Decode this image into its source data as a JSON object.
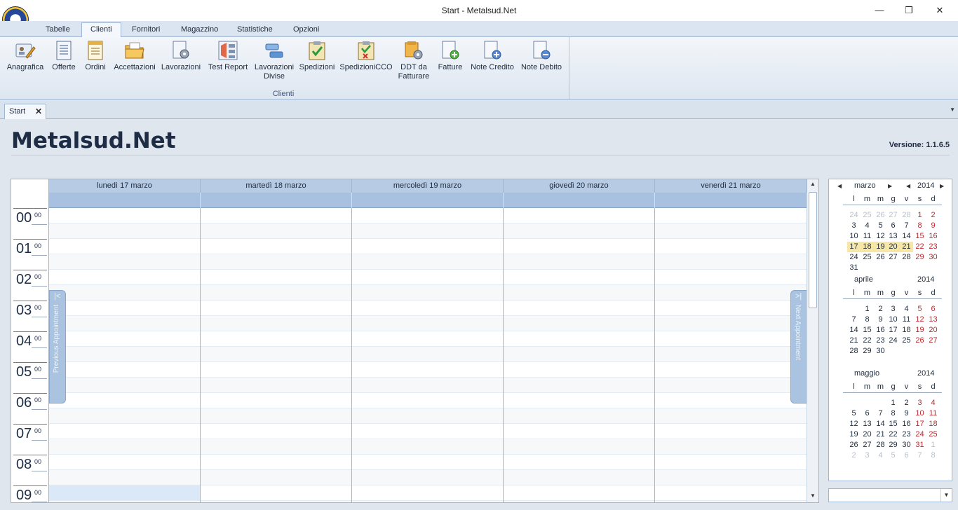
{
  "window": {
    "title": "Start - Metalsud.Net",
    "minimize": "—",
    "restore": "❐",
    "close": "✕"
  },
  "ribbon_tabs": [
    "Tabelle",
    "Clienti",
    "Fornitori",
    "Magazzino",
    "Statistiche",
    "Opzioni"
  ],
  "ribbon": {
    "group_label": "Clienti",
    "buttons": [
      {
        "label": "Anagrafica",
        "icon": "user-card-icon"
      },
      {
        "label": "Offerte",
        "icon": "document-list-icon"
      },
      {
        "label": "Ordini",
        "icon": "order-document-icon"
      },
      {
        "label": "Accettazioni",
        "icon": "folder-icon"
      },
      {
        "label": "Lavorazioni",
        "icon": "document-gear-icon"
      },
      {
        "label": "Test Report",
        "icon": "report-icon"
      },
      {
        "label": "Lavorazioni\nDivise",
        "icon": "split-blocks-icon"
      },
      {
        "label": "Spedizioni",
        "icon": "clipboard-check-icon"
      },
      {
        "label": "SpedizioniCCO",
        "icon": "clipboard-x-icon"
      },
      {
        "label": "DDT da\nFatturare",
        "icon": "ddt-gear-icon"
      },
      {
        "label": "Fatture",
        "icon": "document-add-icon"
      },
      {
        "label": "Note Credito",
        "icon": "document-plus-icon"
      },
      {
        "label": "Note Debito",
        "icon": "document-minus-icon"
      }
    ]
  },
  "doc_tab": {
    "label": "Start",
    "close": "✕"
  },
  "page": {
    "title": "Metalsud.Net",
    "version": "Versione: 1.1.6.5"
  },
  "scheduler": {
    "days": [
      "lunedì 17 marzo",
      "martedì 18 marzo",
      "mercoledì 19 marzo",
      "giovedì 20 marzo",
      "venerdì 21 marzo"
    ],
    "hours": [
      "00",
      "01",
      "02",
      "03",
      "04",
      "05",
      "06",
      "07",
      "08",
      "09"
    ],
    "minutes": "00",
    "prev_label": "Previous Appointment",
    "next_label": "Next Appointment",
    "prev_chevron": "|<",
    "next_chevron": ">|"
  },
  "calendar": {
    "weekdays": [
      "l",
      "m",
      "m",
      "g",
      "v",
      "s",
      "d"
    ],
    "months": [
      {
        "name": "marzo",
        "year": "2014",
        "nav": true,
        "days": [
          "24",
          "25",
          "26",
          "27",
          "28",
          "1",
          "2",
          "3",
          "4",
          "5",
          "6",
          "7",
          "8",
          "9",
          "10",
          "11",
          "12",
          "13",
          "14",
          "15",
          "16",
          "17",
          "18",
          "19",
          "20",
          "21",
          "22",
          "23",
          "24",
          "25",
          "26",
          "27",
          "28",
          "29",
          "30",
          "31"
        ],
        "lead": 5
      },
      {
        "name": "aprile",
        "year": "2014",
        "nav": false,
        "days": [
          "1",
          "2",
          "3",
          "4",
          "5",
          "6",
          "7",
          "8",
          "9",
          "10",
          "11",
          "12",
          "13",
          "14",
          "15",
          "16",
          "17",
          "18",
          "19",
          "20",
          "21",
          "22",
          "23",
          "24",
          "25",
          "26",
          "27",
          "28",
          "29",
          "30"
        ],
        "lead": 0,
        "offset": 1
      },
      {
        "name": "maggio",
        "year": "2014",
        "nav": false,
        "days": [
          "1",
          "2",
          "3",
          "4",
          "5",
          "6",
          "7",
          "8",
          "9",
          "10",
          "11",
          "12",
          "13",
          "14",
          "15",
          "16",
          "17",
          "18",
          "19",
          "20",
          "21",
          "22",
          "23",
          "24",
          "25",
          "26",
          "27",
          "28",
          "29",
          "30",
          "31",
          "1",
          "2",
          "3",
          "4",
          "5",
          "6",
          "7",
          "8"
        ],
        "lead": 0,
        "offset": 3,
        "trail": 8
      }
    ]
  }
}
